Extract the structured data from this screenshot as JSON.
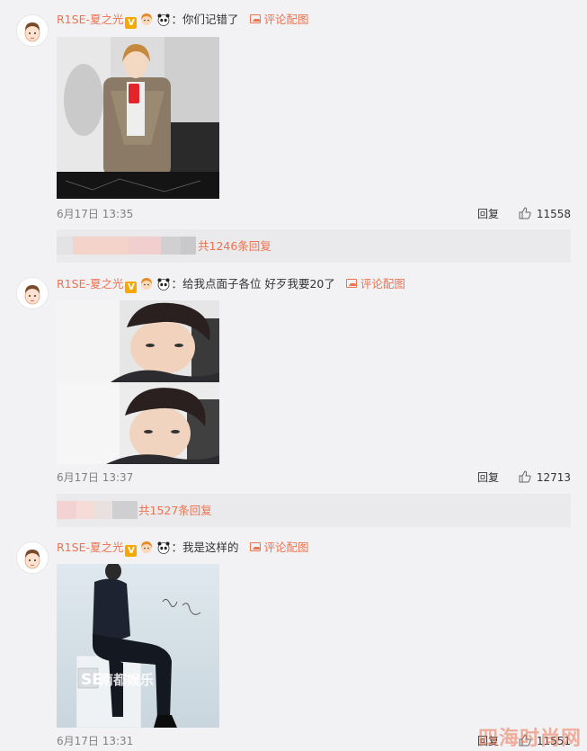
{
  "comments": [
    {
      "username": "R1SE-夏之光",
      "verified": "V",
      "text": "：你们记错了",
      "peitu_label": "评论配图",
      "date": "6月17日 13:35",
      "reply_label": "回复",
      "likes": "11558",
      "replies_total": "共1246条回复"
    },
    {
      "username": "R1SE-夏之光",
      "verified": "V",
      "text": "：给我点面子各位 好歹我要20了",
      "peitu_label": "评论配图",
      "date": "6月17日 13:37",
      "reply_label": "回复",
      "likes": "12713",
      "replies_total": "共1527条回复"
    },
    {
      "username": "R1SE-夏之光",
      "verified": "V",
      "text": "：我是这样的",
      "peitu_label": "评论配图",
      "date": "6月17日 13:31",
      "reply_label": "回复",
      "likes": "11551",
      "image_overlay_text": "SE南都娱乐"
    }
  ],
  "watermark": "四海时尚网",
  "colors": {
    "accent": "#eb7350",
    "background": "#f2f2f5",
    "sub_panel": "#eaeaec"
  }
}
